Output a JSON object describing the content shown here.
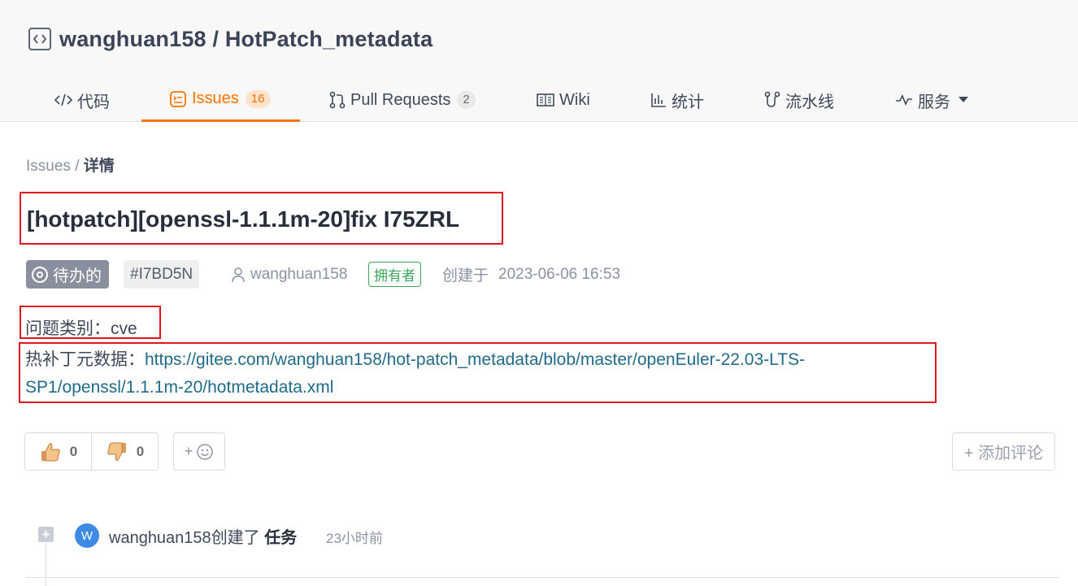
{
  "repo": {
    "title": "wanghuan158 / HotPatch_metadata",
    "icon": "code-square-icon"
  },
  "tabs": [
    {
      "label": "代码",
      "icon": "code-icon"
    },
    {
      "label": "Issues",
      "count": "16",
      "icon": "issues-icon",
      "active": true
    },
    {
      "label": "Pull Requests",
      "count": "2",
      "icon": "pull-request-icon"
    },
    {
      "label": "Wiki",
      "icon": "book-icon"
    },
    {
      "label": "统计",
      "icon": "bar-chart-icon"
    },
    {
      "label": "流水线",
      "icon": "pipeline-icon"
    },
    {
      "label": "服务",
      "icon": "pulse-icon"
    }
  ],
  "breadcrumb": {
    "parent": "Issues",
    "separator": "/",
    "current": "详情"
  },
  "issue": {
    "title": "[hotpatch][openssl-1.1.1m-20]fix I75ZRL",
    "state": "待办的",
    "id": "#I7BD5N",
    "author": "wanghuan158",
    "role": "拥有者",
    "created_label": "创建于",
    "created_at": "2023-06-06 16:53"
  },
  "body": {
    "category_label": "问题类别：",
    "category_value": "cve",
    "metadata_label": "热补丁元数据：",
    "metadata_link_line1": "https://gitee.com/wanghuan158/hot-patch_metadata/blob/master/openEuler-22.03-LTS-",
    "metadata_link_line2": "SP1/openssl/1.1.1m-20/hotmetadata.xml"
  },
  "reactions": {
    "thumbs_up": "0",
    "thumbs_down": "0",
    "add_emoji": "+"
  },
  "add_comment": "+ 添加评论",
  "timeline": [
    {
      "avatar": "W",
      "user": "wanghuan158",
      "action": "创建了",
      "object": "任务",
      "time": "23小时前"
    }
  ],
  "colors": {
    "accent": "#fe7300",
    "link": "#1f6b8a",
    "owner": "#3ba859",
    "highlight_box": "#e0141c"
  }
}
